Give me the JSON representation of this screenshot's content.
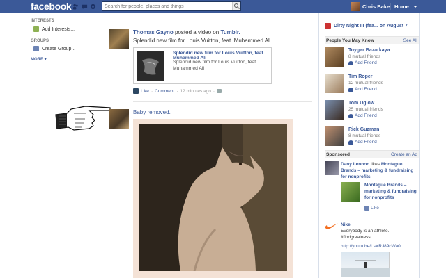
{
  "topbar": {
    "logo": "facebook",
    "search_placeholder": "Search for people, places and things",
    "user_name": "Chris Baker",
    "home_label": "Home"
  },
  "left_nav": {
    "interests_heading": "INTERESTS",
    "add_interests": "Add Interests...",
    "groups_heading": "GROUPS",
    "create_group": "Create Group...",
    "more": "MORE ▾"
  },
  "feed": {
    "post1": {
      "author": "Thomas Gayno",
      "action": "posted a video on",
      "source": "Tumblr.",
      "message": "Splendid new film for Louis Vuitton, feat. Muhammed Ali",
      "attachment_title": "Splendid new film for Louis Vuitton, feat. Muhammed Ali",
      "attachment_desc": "Splendid new film for Louis Vuitton, feat. Muhammed Ali",
      "like": "Like",
      "comment": "Comment",
      "time": "12 minutes ago",
      "dot": "·"
    },
    "post2": {
      "message": "Baby removed."
    }
  },
  "right_column": {
    "event": "Dirty Night III (fea... on August 7",
    "pymk_header": "People You May Know",
    "see_all": "See All",
    "people": [
      {
        "name": "Toygar Bazarkaya",
        "mutual": "8 mutual friends",
        "add": "Add Friend"
      },
      {
        "name": "Tim Roper",
        "mutual": "12 mutual friends",
        "add": "Add Friend"
      },
      {
        "name": "Tom Uglow",
        "mutual": "25 mutual friends",
        "add": "Add Friend"
      },
      {
        "name": "Rick Guzman",
        "mutual": "8 mutual friends",
        "add": "Add Friend"
      }
    ],
    "sponsored_header": "Sponsored",
    "create_ad": "Create an Ad",
    "ad1": {
      "actor": "Dany Lennon",
      "likes": "likes",
      "page": "Montague Brands – marketing & fundraising for nonprofits",
      "card_title": "Montague Brands – marketing & fundraising for nonprofits",
      "like": "Like"
    },
    "ad2": {
      "brand": "Nike",
      "text": "Everybody is an athlete. #findgreatness",
      "link": "http://youtu.be/LsXRJ89cWa0"
    }
  }
}
